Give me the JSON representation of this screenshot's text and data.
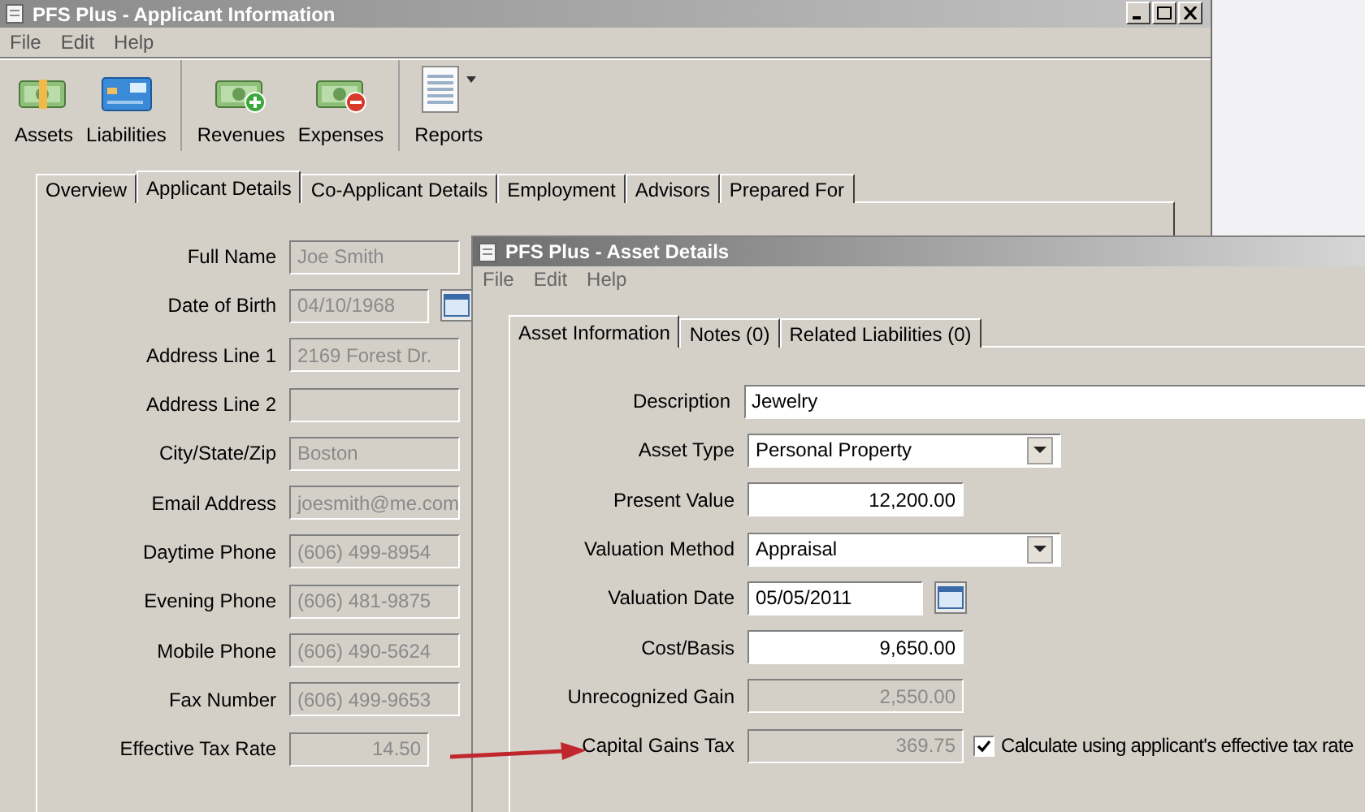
{
  "main_window": {
    "title": "PFS Plus - Applicant Information",
    "menu": [
      "File",
      "Edit",
      "Help"
    ],
    "toolbar": [
      [
        {
          "label": "Assets",
          "kind": "assets"
        },
        {
          "label": "Liabilities",
          "kind": "liabilities"
        }
      ],
      [
        {
          "label": "Revenues",
          "kind": "revenues"
        },
        {
          "label": "Expenses",
          "kind": "expenses"
        }
      ],
      [
        {
          "label": "Reports",
          "kind": "reports"
        }
      ]
    ],
    "tabs": [
      {
        "label": "Overview",
        "selected": false
      },
      {
        "label": "Applicant Details",
        "selected": true
      },
      {
        "label": "Co-Applicant Details",
        "selected": false
      },
      {
        "label": "Employment",
        "selected": false
      },
      {
        "label": "Advisors",
        "selected": false
      },
      {
        "label": "Prepared For",
        "selected": false
      }
    ],
    "fields": [
      {
        "label": "Full Name",
        "value": "Joe Smith",
        "kind": "text",
        "disabled": true
      },
      {
        "label": "Date of Birth",
        "value": "04/10/1968",
        "kind": "date",
        "disabled": true
      },
      {
        "label": "Address Line 1",
        "value": "2169 Forest Dr.",
        "kind": "text",
        "disabled": true
      },
      {
        "label": "Address Line 2",
        "kind": "text",
        "disabled": true
      },
      {
        "label": "City/State/Zip",
        "value": "Boston",
        "kind": "text",
        "disabled": true
      },
      {
        "label": "Email Address",
        "value": "joesmith@me.com",
        "kind": "text",
        "disabled": true
      },
      {
        "label": "Daytime Phone",
        "value": "(606) 499-8954",
        "kind": "text",
        "disabled": true
      },
      {
        "label": "Evening Phone",
        "value": "(606) 481-9875",
        "kind": "text",
        "disabled": true
      },
      {
        "label": "Mobile Phone",
        "value": "(606) 490-5624",
        "kind": "text",
        "disabled": true
      },
      {
        "label": "Fax Number",
        "value": "(606) 499-9653",
        "kind": "text",
        "disabled": true
      },
      {
        "label": "Effective Tax Rate",
        "value": "14.50",
        "kind": "number",
        "disabled": true
      }
    ]
  },
  "asset_window": {
    "title": "PFS Plus - Asset Details",
    "menu": [
      "File",
      "Edit",
      "Help"
    ],
    "tabs": [
      {
        "label": "Asset Information",
        "selected": true
      },
      {
        "label": "Notes (0)",
        "selected": false
      },
      {
        "label": "Related Liabilities (0)",
        "selected": false
      }
    ],
    "fields": [
      {
        "label": "Description",
        "value": "Jewelry",
        "kind": "text",
        "disabled": false
      },
      {
        "label": "Asset Type",
        "value": "Personal Property",
        "kind": "select",
        "disabled": false
      },
      {
        "label": "Present Value",
        "value": "12,200.00",
        "kind": "number",
        "disabled": false
      },
      {
        "label": "Valuation Method",
        "value": "Appraisal",
        "kind": "select",
        "disabled": false
      },
      {
        "label": "Valuation Date",
        "value": "05/05/2011",
        "kind": "date",
        "disabled": false
      },
      {
        "label": "Cost/Basis",
        "value": "9,650.00",
        "kind": "number",
        "disabled": false
      },
      {
        "label": "Unrecognized Gain",
        "value": "2,550.00",
        "kind": "number",
        "disabled": true
      },
      {
        "label": "Capital Gains Tax",
        "value": "369.75",
        "kind": "number",
        "disabled": true
      }
    ],
    "checkbox": {
      "label": "Calculate using applicant's effective tax rate",
      "checked": true
    }
  }
}
